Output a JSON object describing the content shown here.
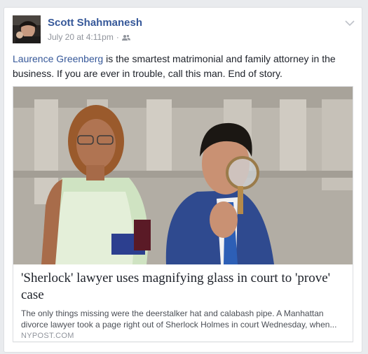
{
  "post": {
    "author_name": "Scott Shahmanesh",
    "timestamp": "July 20 at 4:11pm",
    "separator": "·",
    "audience_icon": "friends-icon",
    "menu_icon": "chevron-down-icon",
    "mention": "Laurence Greenberg",
    "text_rest": " is the smartest matrimonial and family attorney in the business. If you are ever in trouble, call this man. End of story."
  },
  "link_preview": {
    "title": "'Sherlock' lawyer uses magnifying glass in court to 'prove' case",
    "description": "The only things missing were the deerstalker hat and calabash pipe. A Manhattan divorce lawyer took a page right out of Sherlock Holmes in court Wednesday, when...",
    "domain": "NYPOST.COM"
  },
  "colors": {
    "link_blue": "#365899",
    "text": "#1d2129",
    "muted": "#90949c",
    "background": "#e9ebee"
  }
}
